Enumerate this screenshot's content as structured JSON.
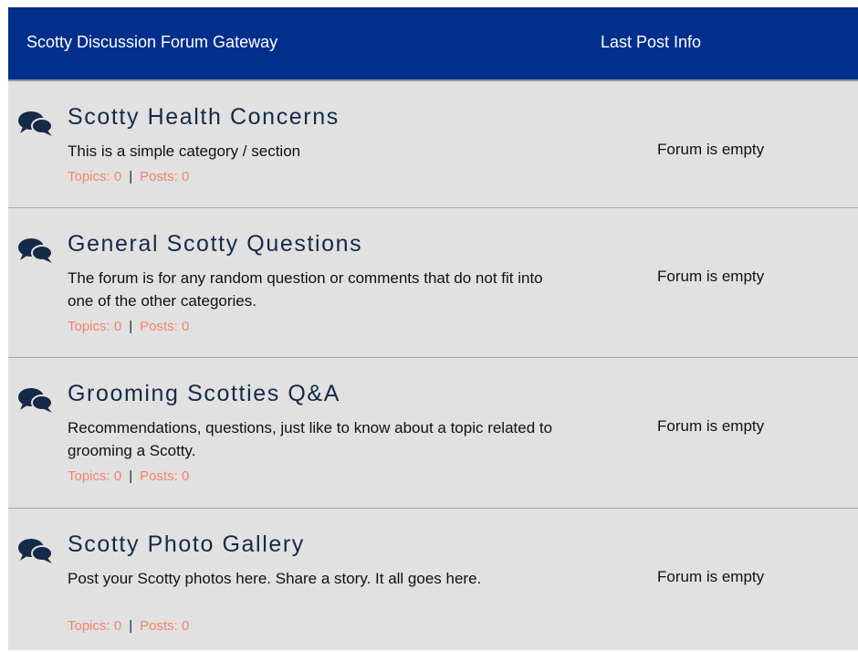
{
  "header": {
    "title": "Scotty Discussion Forum Gateway",
    "last_post_label": "Last Post Info"
  },
  "colors": {
    "header_bg": "#032f8c",
    "row_bg": "#e1e1e1",
    "title": "#152a48",
    "stats": "#f2846a"
  },
  "forums": [
    {
      "icon": "chat-bubbles-icon",
      "title": "Scotty Health Concerns",
      "description": "This is a simple category / section",
      "topics_label": "Topics: 0",
      "separator": "|",
      "posts_label": "Posts: 0",
      "last_post": "Forum is empty"
    },
    {
      "icon": "chat-bubbles-icon",
      "title": "General Scotty Questions",
      "description": "The forum is for any random question or comments that do not fit into one of the other categories.",
      "topics_label": "Topics: 0",
      "separator": "|",
      "posts_label": "Posts: 0",
      "last_post": "Forum is empty"
    },
    {
      "icon": "chat-bubbles-icon",
      "title": "Grooming Scotties Q&A",
      "description": "Recommendations, questions, just like to know about a topic related to grooming a Scotty.",
      "topics_label": "Topics: 0",
      "separator": "|",
      "posts_label": "Posts: 0",
      "last_post": "Forum is empty"
    },
    {
      "icon": "chat-bubbles-icon",
      "title": "Scotty Photo Gallery",
      "description": "Post your Scotty photos here. Share a story. It all goes here.",
      "topics_label": "Topics: 0",
      "separator": "|",
      "posts_label": "Posts: 0",
      "last_post": "Forum is empty"
    }
  ]
}
